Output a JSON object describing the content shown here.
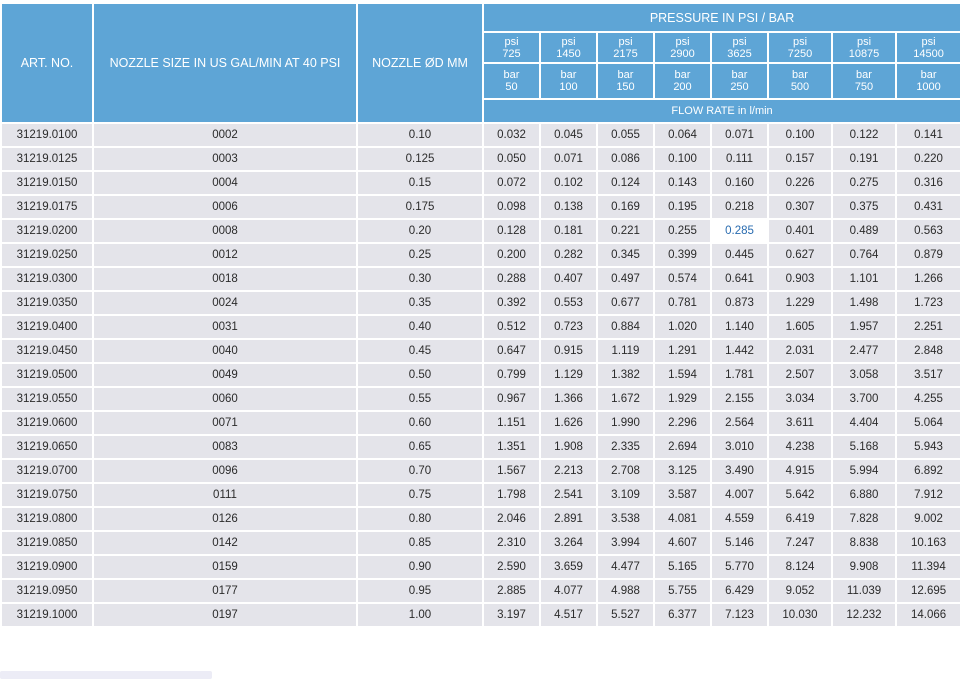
{
  "header": {
    "art_no": "ART. NO.",
    "nozzle_size": "NOZZLE SIZE IN US GAL/MIN AT 40 PSI",
    "nozzle_od": "NOZZLE ØD MM",
    "pressure": "PRESSURE IN PSI / BAR",
    "flow_rate": "FLOW RATE in l/min",
    "psi": [
      {
        "unit": "psi",
        "value": "725"
      },
      {
        "unit": "psi",
        "value": "1450"
      },
      {
        "unit": "psi",
        "value": "2175"
      },
      {
        "unit": "psi",
        "value": "2900"
      },
      {
        "unit": "psi",
        "value": "3625"
      },
      {
        "unit": "psi",
        "value": "7250"
      },
      {
        "unit": "psi",
        "value": "10875"
      },
      {
        "unit": "psi",
        "value": "14500"
      }
    ],
    "bar": [
      {
        "unit": "bar",
        "value": "50"
      },
      {
        "unit": "bar",
        "value": "100"
      },
      {
        "unit": "bar",
        "value": "150"
      },
      {
        "unit": "bar",
        "value": "200"
      },
      {
        "unit": "bar",
        "value": "250"
      },
      {
        "unit": "bar",
        "value": "500"
      },
      {
        "unit": "bar",
        "value": "750"
      },
      {
        "unit": "bar",
        "value": "1000"
      }
    ]
  },
  "rows": [
    {
      "art": "31219.0100",
      "size": "0002",
      "od": "0.10",
      "flow": [
        "0.032",
        "0.045",
        "0.055",
        "0.064",
        "0.071",
        "0.100",
        "0.122",
        "0.141"
      ]
    },
    {
      "art": "31219.0125",
      "size": "0003",
      "od": "0.125",
      "flow": [
        "0.050",
        "0.071",
        "0.086",
        "0.100",
        "0.111",
        "0.157",
        "0.191",
        "0.220"
      ]
    },
    {
      "art": "31219.0150",
      "size": "0004",
      "od": "0.15",
      "flow": [
        "0.072",
        "0.102",
        "0.124",
        "0.143",
        "0.160",
        "0.226",
        "0.275",
        "0.316"
      ]
    },
    {
      "art": "31219.0175",
      "size": "0006",
      "od": "0.175",
      "flow": [
        "0.098",
        "0.138",
        "0.169",
        "0.195",
        "0.218",
        "0.307",
        "0.375",
        "0.431"
      ]
    },
    {
      "art": "31219.0200",
      "size": "0008",
      "od": "0.20",
      "flow": [
        "0.128",
        "0.181",
        "0.221",
        "0.255",
        "0.285",
        "0.401",
        "0.489",
        "0.563"
      ]
    },
    {
      "art": "31219.0250",
      "size": "0012",
      "od": "0.25",
      "flow": [
        "0.200",
        "0.282",
        "0.345",
        "0.399",
        "0.445",
        "0.627",
        "0.764",
        "0.879"
      ]
    },
    {
      "art": "31219.0300",
      "size": "0018",
      "od": "0.30",
      "flow": [
        "0.288",
        "0.407",
        "0.497",
        "0.574",
        "0.641",
        "0.903",
        "1.101",
        "1.266"
      ]
    },
    {
      "art": "31219.0350",
      "size": "0024",
      "od": "0.35",
      "flow": [
        "0.392",
        "0.553",
        "0.677",
        "0.781",
        "0.873",
        "1.229",
        "1.498",
        "1.723"
      ]
    },
    {
      "art": "31219.0400",
      "size": "0031",
      "od": "0.40",
      "flow": [
        "0.512",
        "0.723",
        "0.884",
        "1.020",
        "1.140",
        "1.605",
        "1.957",
        "2.251"
      ]
    },
    {
      "art": "31219.0450",
      "size": "0040",
      "od": "0.45",
      "flow": [
        "0.647",
        "0.915",
        "1.119",
        "1.291",
        "1.442",
        "2.031",
        "2.477",
        "2.848"
      ]
    },
    {
      "art": "31219.0500",
      "size": "0049",
      "od": "0.50",
      "flow": [
        "0.799",
        "1.129",
        "1.382",
        "1.594",
        "1.781",
        "2.507",
        "3.058",
        "3.517"
      ]
    },
    {
      "art": "31219.0550",
      "size": "0060",
      "od": "0.55",
      "flow": [
        "0.967",
        "1.366",
        "1.672",
        "1.929",
        "2.155",
        "3.034",
        "3.700",
        "4.255"
      ]
    },
    {
      "art": "31219.0600",
      "size": "0071",
      "od": "0.60",
      "flow": [
        "1.151",
        "1.626",
        "1.990",
        "2.296",
        "2.564",
        "3.611",
        "4.404",
        "5.064"
      ]
    },
    {
      "art": "31219.0650",
      "size": "0083",
      "od": "0.65",
      "flow": [
        "1.351",
        "1.908",
        "2.335",
        "2.694",
        "3.010",
        "4.238",
        "5.168",
        "5.943"
      ]
    },
    {
      "art": "31219.0700",
      "size": "0096",
      "od": "0.70",
      "flow": [
        "1.567",
        "2.213",
        "2.708",
        "3.125",
        "3.490",
        "4.915",
        "5.994",
        "6.892"
      ]
    },
    {
      "art": "31219.0750",
      "size": "0111",
      "od": "0.75",
      "flow": [
        "1.798",
        "2.541",
        "3.109",
        "3.587",
        "4.007",
        "5.642",
        "6.880",
        "7.912"
      ]
    },
    {
      "art": "31219.0800",
      "size": "0126",
      "od": "0.80",
      "flow": [
        "2.046",
        "2.891",
        "3.538",
        "4.081",
        "4.559",
        "6.419",
        "7.828",
        "9.002"
      ]
    },
    {
      "art": "31219.0850",
      "size": "0142",
      "od": "0.85",
      "flow": [
        "2.310",
        "3.264",
        "3.994",
        "4.607",
        "5.146",
        "7.247",
        "8.838",
        "10.163"
      ]
    },
    {
      "art": "31219.0900",
      "size": "0159",
      "od": "0.90",
      "flow": [
        "2.590",
        "3.659",
        "4.477",
        "5.165",
        "5.770",
        "8.124",
        "9.908",
        "11.394"
      ]
    },
    {
      "art": "31219.0950",
      "size": "0177",
      "od": "0.95",
      "flow": [
        "2.885",
        "4.077",
        "4.988",
        "5.755",
        "6.429",
        "9.052",
        "11.039",
        "12.695"
      ]
    },
    {
      "art": "31219.1000",
      "size": "0197",
      "od": "1.00",
      "flow": [
        "3.197",
        "4.517",
        "5.527",
        "6.377",
        "7.123",
        "10.030",
        "12.232",
        "14.066"
      ]
    }
  ],
  "highlight": {
    "row": 4,
    "col": 4,
    "text_color": "#2a6cb0"
  },
  "colors": {
    "header_bg": "#5ea5d6",
    "cell_bg": "#e4e4ea",
    "highlight_bg": "#ffffff"
  }
}
